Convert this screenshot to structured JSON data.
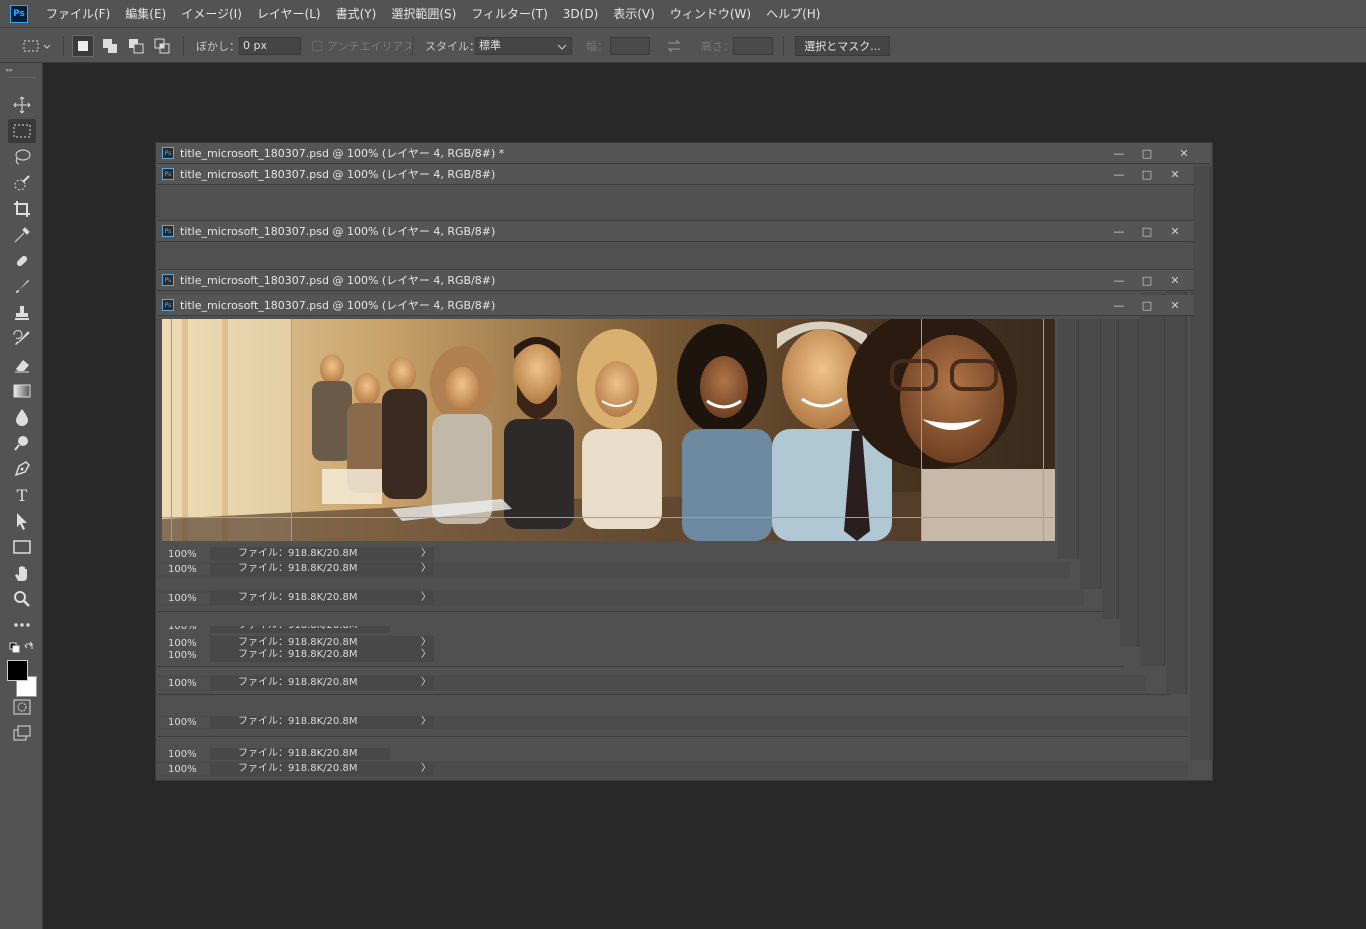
{
  "app": {
    "logo_text": "Ps"
  },
  "menu": {
    "items": [
      "ファイル(F)",
      "編集(E)",
      "イメージ(I)",
      "レイヤー(L)",
      "書式(Y)",
      "選択範囲(S)",
      "フィルター(T)",
      "3D(D)",
      "表示(V)",
      "ウィンドウ(W)",
      "ヘルプ(H)"
    ]
  },
  "options": {
    "feather_label": "ぼかし：",
    "feather_value": "0 px",
    "antialias_label": "アンチエイリアス",
    "style_label": "スタイル：",
    "style_value": "標準",
    "width_label": "幅：",
    "height_label": "高さ：",
    "select_mask_label": "選択とマスク..."
  },
  "toolbar": {
    "tools": [
      "move-tool",
      "rectangular-marquee-tool",
      "lasso-tool",
      "quick-selection-tool",
      "crop-tool",
      "eyedropper-tool",
      "healing-brush-tool",
      "brush-tool",
      "clone-stamp-tool",
      "history-brush-tool",
      "eraser-tool",
      "gradient-tool",
      "blur-tool",
      "dodge-tool",
      "pen-tool",
      "type-tool",
      "path-selection-tool",
      "rectangle-tool",
      "hand-tool",
      "zoom-tool",
      "more-tools"
    ],
    "active_tool": "rectangular-marquee-tool",
    "foreground_color": "#000000",
    "background_color": "#ffffff"
  },
  "document": {
    "title_active": "title_microsoft_180307.psd @ 100% (レイヤー 4, RGB/8#) *",
    "title": "title_microsoft_180307.psd @ 100% (レイヤー 4, RGB/8#)",
    "zoom": "100%",
    "file_info": "ファイル：918.8K/20.8M",
    "status_arrow": "〉",
    "window_controls": {
      "minimize": "—",
      "maximize": "□",
      "close": "✕"
    }
  },
  "colors": {
    "panel": "#535353",
    "workspace": "#282828",
    "guide": "#22d6cf",
    "ps_blue": "#31a8ff"
  }
}
